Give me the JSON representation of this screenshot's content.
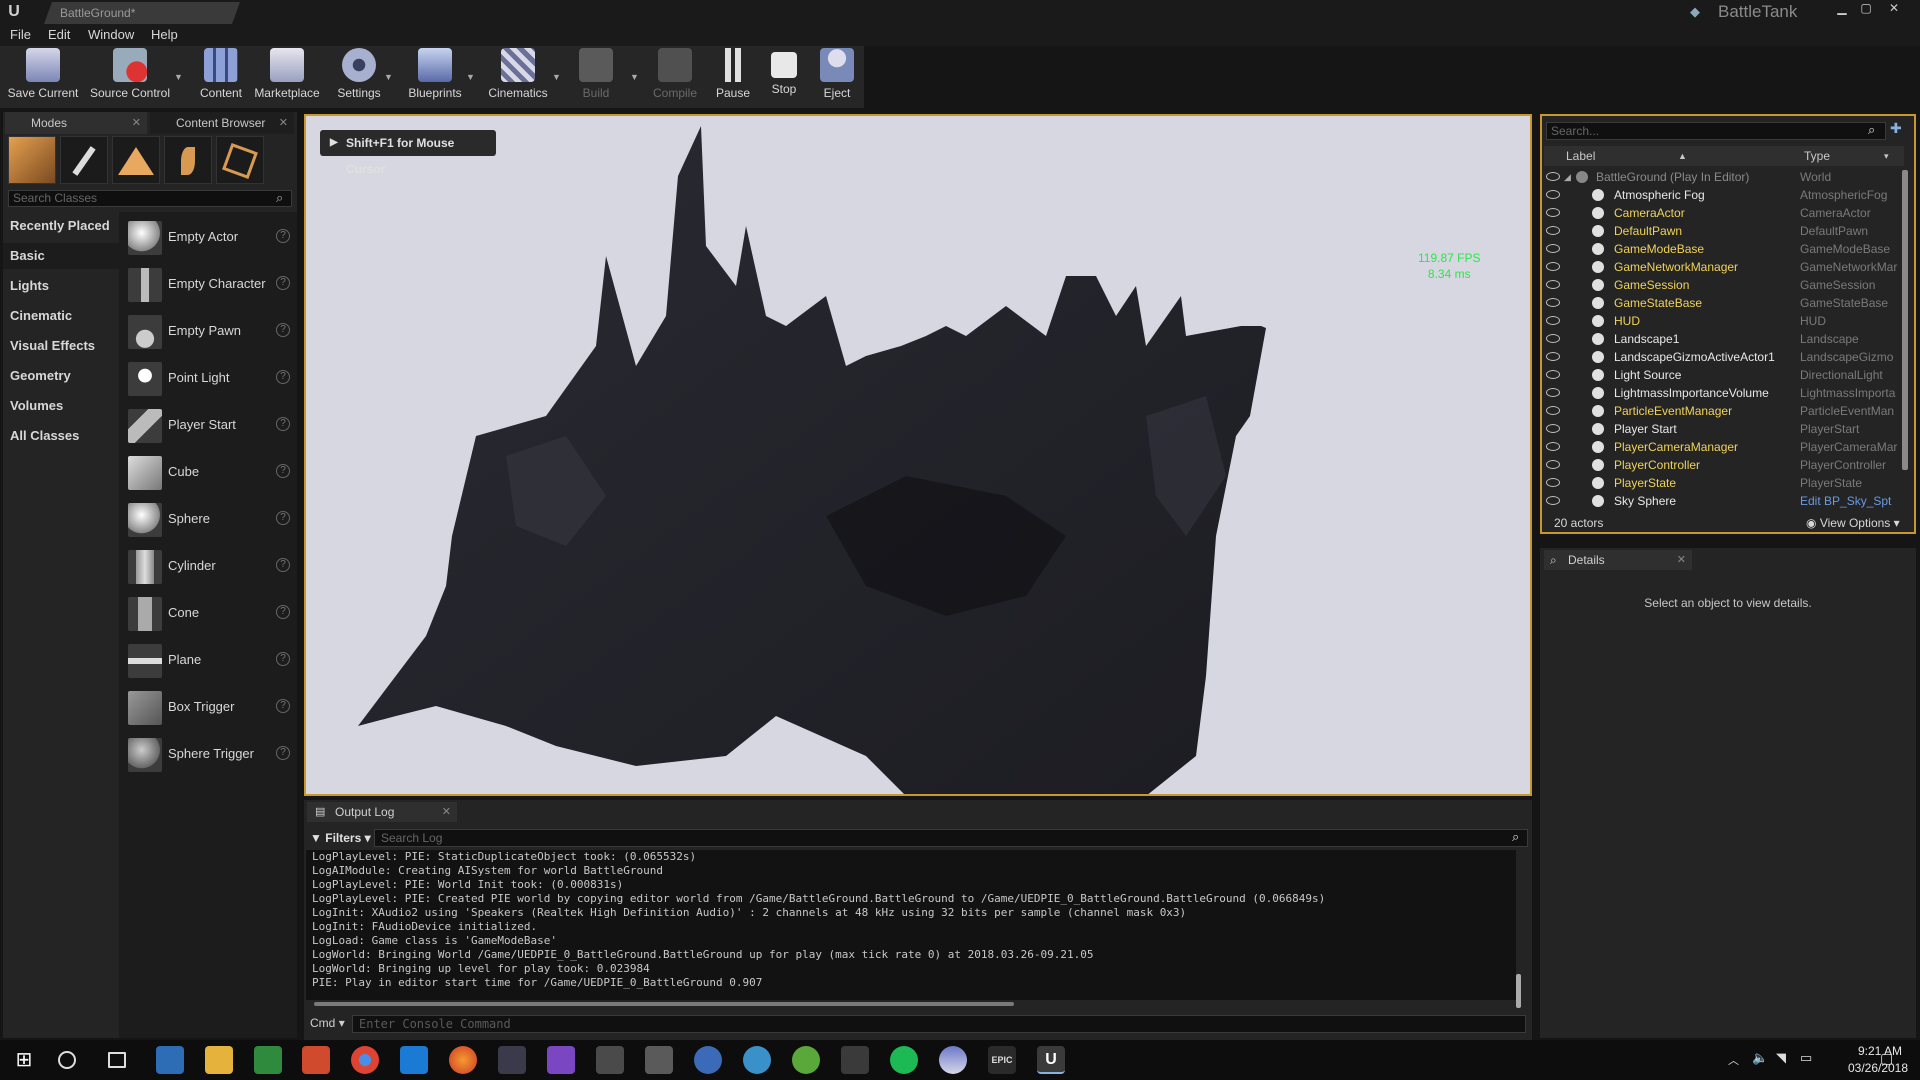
{
  "window": {
    "tab_title": "BattleGround*",
    "project_name": "BattleTank"
  },
  "menu": [
    "File",
    "Edit",
    "Window",
    "Help"
  ],
  "toolbar": {
    "buttons": [
      {
        "label": "Save Current"
      },
      {
        "label": "Source Control"
      },
      {
        "label": "Content"
      },
      {
        "label": "Marketplace"
      },
      {
        "label": "Settings"
      },
      {
        "label": "Blueprints"
      },
      {
        "label": "Cinematics"
      },
      {
        "label": "Build"
      },
      {
        "label": "Compile"
      },
      {
        "label": "Pause"
      },
      {
        "label": "Stop"
      },
      {
        "label": "Eject"
      }
    ]
  },
  "left_panel": {
    "tabs": [
      "Modes",
      "Content Browser"
    ],
    "search_placeholder": "Search Classes",
    "categories": [
      "Recently Placed",
      "Basic",
      "Lights",
      "Cinematic",
      "Visual Effects",
      "Geometry",
      "Volumes",
      "All Classes"
    ],
    "active_category": "Basic",
    "items": [
      "Empty Actor",
      "Empty Character",
      "Empty Pawn",
      "Point Light",
      "Player Start",
      "Cube",
      "Sphere",
      "Cylinder",
      "Cone",
      "Plane",
      "Box Trigger",
      "Sphere Trigger"
    ]
  },
  "viewport": {
    "mouse_hint": "Shift+F1 for Mouse Cursor",
    "fps": "119.87 FPS",
    "frame_ms": "8.34 ms"
  },
  "output_log": {
    "tab": "Output Log",
    "filters_label": "Filters",
    "search_placeholder": "Search Log",
    "lines": [
      "LogPlayLevel: PIE: StaticDuplicateObject took: (0.065532s)",
      "LogAIModule: Creating AISystem for world BattleGround",
      "LogPlayLevel: PIE: World Init took: (0.000831s)",
      "LogPlayLevel: PIE: Created PIE world by copying editor world from /Game/BattleGround.BattleGround to /Game/UEDPIE_0_BattleGround.BattleGround (0.066849s)",
      "LogInit: XAudio2 using 'Speakers (Realtek High Definition Audio)' : 2 channels at 48 kHz using 32 bits per sample (channel mask 0x3)",
      "LogInit: FAudioDevice initialized.",
      "LogLoad: Game class is 'GameModeBase'",
      "LogWorld: Bringing World /Game/UEDPIE_0_BattleGround.BattleGround up for play (max tick rate 0) at 2018.03.26-09.21.05",
      "LogWorld: Bringing up level for play took: 0.023984",
      "PIE: Play in editor start time for /Game/UEDPIE_0_BattleGround 0.907"
    ],
    "cmd_label": "Cmd",
    "cmd_placeholder": "Enter Console Command"
  },
  "outliner": {
    "search_placeholder": "Search...",
    "col_label": "Label",
    "col_type": "Type",
    "rows": [
      {
        "label": "BattleGround (Play In Editor)",
        "type": "World",
        "style": "grey"
      },
      {
        "label": "Atmospheric Fog",
        "type": "AtmosphericFog",
        "style": "white"
      },
      {
        "label": "CameraActor",
        "type": "CameraActor",
        "style": "yellow"
      },
      {
        "label": "DefaultPawn",
        "type": "DefaultPawn",
        "style": "yellow"
      },
      {
        "label": "GameModeBase",
        "type": "GameModeBase",
        "style": "yellow"
      },
      {
        "label": "GameNetworkManager",
        "type": "GameNetworkMar",
        "style": "yellow"
      },
      {
        "label": "GameSession",
        "type": "GameSession",
        "style": "yellow"
      },
      {
        "label": "GameStateBase",
        "type": "GameStateBase",
        "style": "yellow"
      },
      {
        "label": "HUD",
        "type": "HUD",
        "style": "yellow"
      },
      {
        "label": "Landscape1",
        "type": "Landscape",
        "style": "white"
      },
      {
        "label": "LandscapeGizmoActiveActor1",
        "type": "LandscapeGizmo",
        "style": "white"
      },
      {
        "label": "Light Source",
        "type": "DirectionalLight",
        "style": "white"
      },
      {
        "label": "LightmassImportanceVolume",
        "type": "LightmassImporta",
        "style": "white"
      },
      {
        "label": "ParticleEventManager",
        "type": "ParticleEventMan",
        "style": "yellow"
      },
      {
        "label": "Player Start",
        "type": "PlayerStart",
        "style": "white"
      },
      {
        "label": "PlayerCameraManager",
        "type": "PlayerCameraMar",
        "style": "yellow"
      },
      {
        "label": "PlayerController",
        "type": "PlayerController",
        "style": "yellow"
      },
      {
        "label": "PlayerState",
        "type": "PlayerState",
        "style": "yellow"
      },
      {
        "label": "Sky Sphere",
        "type": "Edit BP_Sky_Spt",
        "style": "white"
      }
    ],
    "actor_count": "20 actors",
    "view_options": "View Options"
  },
  "details": {
    "tab": "Details",
    "empty_message": "Select an object to view details."
  },
  "taskbar": {
    "time": "9:21 AM",
    "date": "03/26/2018"
  },
  "colors": {
    "accent": "#c8972e",
    "fps_green": "#2ee54a",
    "actor_yellow": "#f0d25a"
  }
}
